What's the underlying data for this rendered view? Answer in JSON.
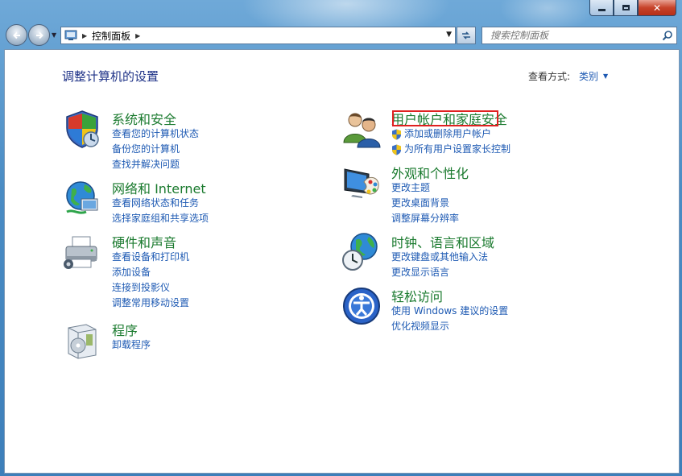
{
  "address": {
    "breadcrumb": "控制面板"
  },
  "search": {
    "placeholder": "搜索控制面板"
  },
  "header": {
    "title": "调整计算机的设置",
    "view_by_label": "查看方式:",
    "view_by_value": "类别"
  },
  "categories": [
    {
      "title": "系统和安全",
      "links": [
        "查看您的计算机状态",
        "备份您的计算机",
        "查找并解决问题"
      ],
      "icon": "shield-icon"
    },
    {
      "title": "网络和 Internet",
      "links": [
        "查看网络状态和任务",
        "选择家庭组和共享选项"
      ],
      "icon": "network-globe-icon"
    },
    {
      "title": "硬件和声音",
      "links": [
        "查看设备和打印机",
        "添加设备",
        "连接到投影仪",
        "调整常用移动设置"
      ],
      "icon": "printer-icon"
    },
    {
      "title": "程序",
      "links": [
        "卸载程序"
      ],
      "icon": "programs-box-icon"
    },
    {
      "title": "用户帐户和家庭安全",
      "links": [
        "添加或删除用户帐户",
        "为所有用户设置家长控制"
      ],
      "icon": "users-icon"
    },
    {
      "title": "外观和个性化",
      "links": [
        "更改主题",
        "更改桌面背景",
        "调整屏幕分辨率"
      ],
      "icon": "monitor-palette-icon"
    },
    {
      "title": "时钟、语言和区域",
      "links": [
        "更改键盘或其他输入法",
        "更改显示语言"
      ],
      "icon": "clock-globe-icon"
    },
    {
      "title": "轻松访问",
      "links": [
        "使用 Windows 建议的设置",
        "优化视频显示"
      ],
      "icon": "ease-of-access-icon"
    }
  ],
  "colors": {
    "category_title": "#1a7a2e",
    "link": "#1e5ab3",
    "page_title": "#1e3287",
    "highlight": "#e02020"
  }
}
